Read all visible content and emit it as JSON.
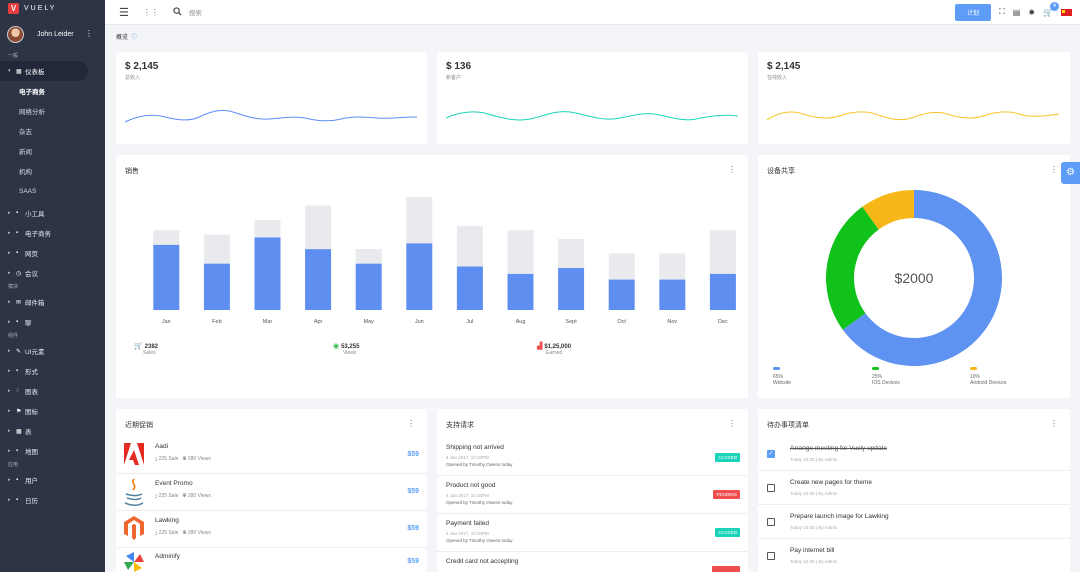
{
  "app": {
    "logo_letter": "V",
    "logo_text": "VUELY"
  },
  "user": {
    "name": "John Leider"
  },
  "sidebar": {
    "sections": [
      "一般",
      "模块",
      "组件",
      "应用"
    ],
    "dashboard": "仪表板",
    "sub_items": [
      "电子商务",
      "网络分析",
      "杂志",
      "新闻",
      "机构",
      "SAAS"
    ],
    "items_general": [
      "小工具",
      "电子商务",
      "网页",
      "会议"
    ],
    "items_modules": [
      "邮件箱",
      "聊"
    ],
    "items_components": [
      "UI元素",
      "形式",
      "图表",
      "图标",
      "表",
      "地图"
    ],
    "items_apps": [
      "用户",
      "日历"
    ]
  },
  "topbar": {
    "search_placeholder": "搜索",
    "plan_button": "计划",
    "cart_badge": "4"
  },
  "breadcrumb": "概览",
  "stats": [
    {
      "value": "$ 2,145",
      "label": "总收入",
      "color": "#5e8df7"
    },
    {
      "value": "$ 136",
      "label": "新客户",
      "color": "#1bd3b9"
    },
    {
      "value": "$ 2,145",
      "label": "在线收入",
      "color": "#f7c325"
    }
  ],
  "sales": {
    "title": "销售",
    "summary": [
      {
        "value": "2382",
        "label": "Sales",
        "icon": "cart-icon",
        "color": "#5e9df7"
      },
      {
        "value": "53,255",
        "label": "Views",
        "icon": "eye-icon",
        "color": "#2bb94a"
      },
      {
        "value": "$1,25,000",
        "label": "Earned",
        "icon": "bar-chart-icon",
        "color": "#f04e4e"
      }
    ]
  },
  "chart_data": [
    {
      "type": "bar",
      "categories": [
        "Jan",
        "Feb",
        "Mar",
        "Apr",
        "May",
        "Jun",
        "Jul",
        "Aug",
        "Sept",
        "Oct",
        "Nov",
        "Dec"
      ],
      "series": [
        {
          "values": [
            45,
            32,
            50,
            42,
            32,
            46,
            30,
            25,
            29,
            21,
            21,
            25
          ],
          "color": "#5e8ef0"
        },
        {
          "values": [
            10,
            20,
            12,
            30,
            10,
            32,
            28,
            30,
            20,
            18,
            18,
            30
          ],
          "color": "#e8eaed"
        }
      ],
      "stacked": true,
      "grid": false
    },
    {
      "type": "pie",
      "title": "设备共享",
      "center_label": "$2000",
      "labels": [
        "Website",
        "IOS Devices",
        "Android Devices"
      ],
      "values": [
        65,
        25,
        10
      ],
      "value_labels": [
        "65%",
        "25%",
        "10%"
      ],
      "colors": [
        "#5e93f2",
        "#11c21a",
        "#f7b718"
      ]
    }
  ],
  "promotions": {
    "title": "近期促销",
    "items": [
      {
        "name": "Aadi",
        "sales": "225 Sale",
        "views": "280 Views",
        "price": "$59",
        "icon": "adobe-icon"
      },
      {
        "name": "Event Promo",
        "sales": "225 Sale",
        "views": "280 Views",
        "price": "$59",
        "icon": "java-icon"
      },
      {
        "name": "Lawking",
        "sales": "225 Sale",
        "views": "280 Views",
        "price": "$59",
        "icon": "magento-icon"
      },
      {
        "name": "Adminify",
        "price": "$59",
        "icon": "pinwheel-icon"
      }
    ]
  },
  "support": {
    "title": "支持请求",
    "items": [
      {
        "title": "Shipping not arrived",
        "date": "4 Jan 2017, 10:10PM",
        "by": "Opened by Timothy Owens today",
        "status": "CLOSED",
        "status_color": "#1bd3b9"
      },
      {
        "title": "Product not good",
        "date": "4 Jan 2017, 10:10PM",
        "by": "Opened by Timothy Owens today",
        "status": "PENDING",
        "status_color": "#f04e4e"
      },
      {
        "title": "Payment failed",
        "date": "4 Jan 2017, 10:10PM",
        "by": "Opened by Timothy Owens today",
        "status": "CLOSED",
        "status_color": "#1bd3b9"
      },
      {
        "title": "Credit card not accepting",
        "status_color": "#f04e4e"
      }
    ]
  },
  "todo": {
    "title": "待办事项清单",
    "items": [
      {
        "text": "Arrange meeting for Vuely update",
        "meta": "Today 10:30 | By Admin",
        "done": true
      },
      {
        "text": "Create new pages for theme",
        "meta": "Today 10:30 | By Admin",
        "done": false
      },
      {
        "text": "Prepare launch image for Lawking",
        "meta": "Today 10:30 | By Admin",
        "done": false
      },
      {
        "text": "Pay internet bill",
        "meta": "Today 10:30 | By Admin",
        "done": false
      }
    ]
  }
}
